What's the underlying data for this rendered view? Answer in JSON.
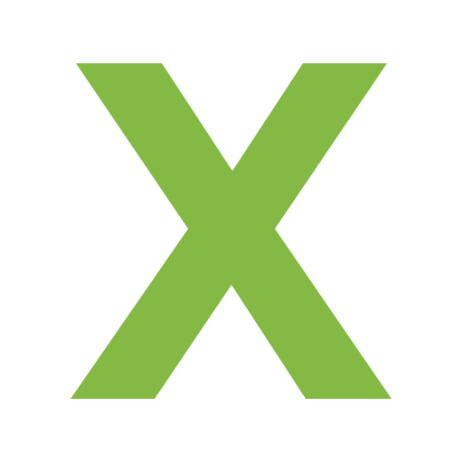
{
  "icon": {
    "name": "x-letter-icon",
    "glyph": "X",
    "color": "#84BA44",
    "background": "#ffffff"
  }
}
